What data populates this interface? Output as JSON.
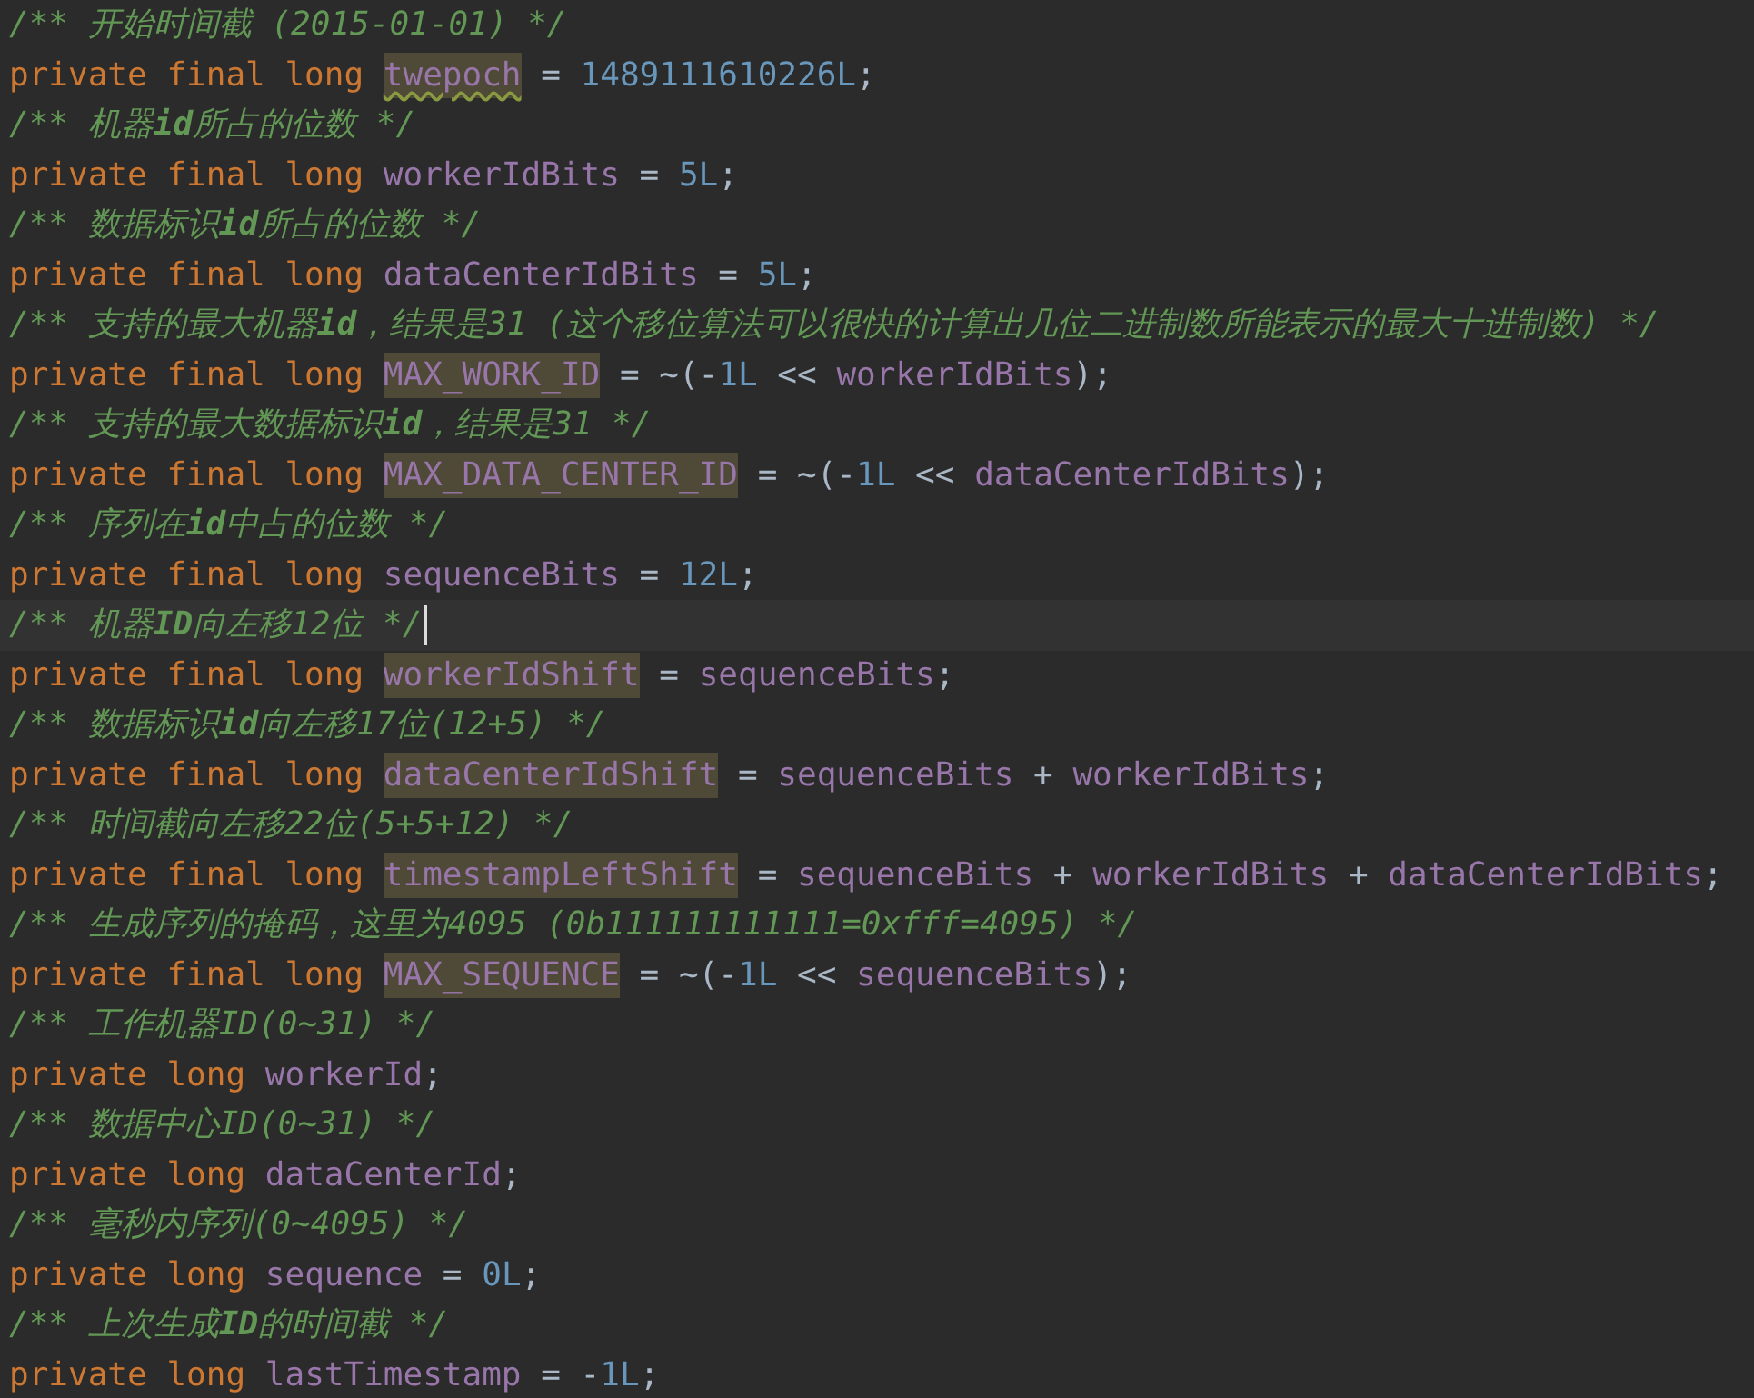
{
  "editor": {
    "lines": [
      {
        "kind": "comment",
        "current": false,
        "text": "/** 开始时间截 (2015-01-01) */"
      },
      {
        "kind": "code",
        "current": false,
        "tokens": [
          {
            "kind": "keyword",
            "text": "private final long "
          },
          {
            "kind": "field",
            "text": "twepoch",
            "highlighted": true,
            "warning": true
          },
          {
            "kind": "plain",
            "text": " = "
          },
          {
            "kind": "number",
            "text": "1489111610226L"
          },
          {
            "kind": "plain",
            "text": ";"
          }
        ]
      },
      {
        "kind": "comment",
        "current": false,
        "text": "/** 机器**id**所占的位数 */"
      },
      {
        "kind": "code",
        "current": false,
        "tokens": [
          {
            "kind": "keyword",
            "text": "private final long "
          },
          {
            "kind": "field",
            "text": "workerIdBits",
            "highlighted": false,
            "warning": false
          },
          {
            "kind": "plain",
            "text": " = "
          },
          {
            "kind": "number",
            "text": "5L"
          },
          {
            "kind": "plain",
            "text": ";"
          }
        ]
      },
      {
        "kind": "comment",
        "current": false,
        "text": "/** 数据标识**id**所占的位数 */"
      },
      {
        "kind": "code",
        "current": false,
        "tokens": [
          {
            "kind": "keyword",
            "text": "private final long "
          },
          {
            "kind": "field",
            "text": "dataCenterIdBits",
            "highlighted": false,
            "warning": false
          },
          {
            "kind": "plain",
            "text": " = "
          },
          {
            "kind": "number",
            "text": "5L"
          },
          {
            "kind": "plain",
            "text": ";"
          }
        ]
      },
      {
        "kind": "comment",
        "current": false,
        "text": "/** 支持的最大机器**id**，结果是31 (这个移位算法可以很快的计算出几位二进制数所能表示的最大十进制数) */"
      },
      {
        "kind": "code",
        "current": false,
        "tokens": [
          {
            "kind": "keyword",
            "text": "private final long "
          },
          {
            "kind": "field",
            "text": "MAX_WORK_ID",
            "highlighted": true,
            "warning": false
          },
          {
            "kind": "plain",
            "text": " = ~(-"
          },
          {
            "kind": "number",
            "text": "1L"
          },
          {
            "kind": "plain",
            "text": " << "
          },
          {
            "kind": "field",
            "text": "workerIdBits",
            "highlighted": false,
            "warning": false
          },
          {
            "kind": "plain",
            "text": ");"
          }
        ]
      },
      {
        "kind": "comment",
        "current": false,
        "text": "/** 支持的最大数据标识**id**，结果是31 */"
      },
      {
        "kind": "code",
        "current": false,
        "tokens": [
          {
            "kind": "keyword",
            "text": "private final long "
          },
          {
            "kind": "field",
            "text": "MAX_DATA_CENTER_ID",
            "highlighted": true,
            "warning": false
          },
          {
            "kind": "plain",
            "text": " = ~(-"
          },
          {
            "kind": "number",
            "text": "1L"
          },
          {
            "kind": "plain",
            "text": " << "
          },
          {
            "kind": "field",
            "text": "dataCenterIdBits",
            "highlighted": false,
            "warning": false
          },
          {
            "kind": "plain",
            "text": ");"
          }
        ]
      },
      {
        "kind": "comment",
        "current": false,
        "text": "/** 序列在**id**中占的位数 */"
      },
      {
        "kind": "code",
        "current": false,
        "tokens": [
          {
            "kind": "keyword",
            "text": "private final long "
          },
          {
            "kind": "field",
            "text": "sequenceBits",
            "highlighted": false,
            "warning": false
          },
          {
            "kind": "plain",
            "text": " = "
          },
          {
            "kind": "number",
            "text": "12L"
          },
          {
            "kind": "plain",
            "text": ";"
          }
        ]
      },
      {
        "kind": "comment",
        "current": true,
        "text": "/** 机器**ID**向左移12位 */"
      },
      {
        "kind": "code",
        "current": false,
        "tokens": [
          {
            "kind": "keyword",
            "text": "private final long "
          },
          {
            "kind": "field",
            "text": "workerIdShift",
            "highlighted": true,
            "warning": false
          },
          {
            "kind": "plain",
            "text": " = "
          },
          {
            "kind": "field",
            "text": "sequenceBits",
            "highlighted": false,
            "warning": false
          },
          {
            "kind": "plain",
            "text": ";"
          }
        ]
      },
      {
        "kind": "comment",
        "current": false,
        "text": "/** 数据标识**id**向左移17位(12+5) */"
      },
      {
        "kind": "code",
        "current": false,
        "tokens": [
          {
            "kind": "keyword",
            "text": "private final long "
          },
          {
            "kind": "field",
            "text": "dataCenterIdShift",
            "highlighted": true,
            "warning": false
          },
          {
            "kind": "plain",
            "text": " = "
          },
          {
            "kind": "field",
            "text": "sequenceBits",
            "highlighted": false,
            "warning": false
          },
          {
            "kind": "plain",
            "text": " + "
          },
          {
            "kind": "field",
            "text": "workerIdBits",
            "highlighted": false,
            "warning": false
          },
          {
            "kind": "plain",
            "text": ";"
          }
        ]
      },
      {
        "kind": "comment",
        "current": false,
        "text": "/** 时间截向左移22位(5+5+12) */"
      },
      {
        "kind": "code",
        "current": false,
        "tokens": [
          {
            "kind": "keyword",
            "text": "private final long "
          },
          {
            "kind": "field",
            "text": "timestampLeftShift",
            "highlighted": true,
            "warning": false
          },
          {
            "kind": "plain",
            "text": " = "
          },
          {
            "kind": "field",
            "text": "sequenceBits",
            "highlighted": false,
            "warning": false
          },
          {
            "kind": "plain",
            "text": " + "
          },
          {
            "kind": "field",
            "text": "workerIdBits",
            "highlighted": false,
            "warning": false
          },
          {
            "kind": "plain",
            "text": " + "
          },
          {
            "kind": "field",
            "text": "dataCenterIdBits",
            "highlighted": false,
            "warning": false
          },
          {
            "kind": "plain",
            "text": ";"
          }
        ]
      },
      {
        "kind": "comment",
        "current": false,
        "text": "/** 生成序列的掩码，这里为4095 (0b111111111111=0xfff=4095) */"
      },
      {
        "kind": "code",
        "current": false,
        "tokens": [
          {
            "kind": "keyword",
            "text": "private final long "
          },
          {
            "kind": "field",
            "text": "MAX_SEQUENCE",
            "highlighted": true,
            "warning": false
          },
          {
            "kind": "plain",
            "text": " = ~(-"
          },
          {
            "kind": "number",
            "text": "1L"
          },
          {
            "kind": "plain",
            "text": " << "
          },
          {
            "kind": "field",
            "text": "sequenceBits",
            "highlighted": false,
            "warning": false
          },
          {
            "kind": "plain",
            "text": ");"
          }
        ]
      },
      {
        "kind": "comment",
        "current": false,
        "text": "/** 工作机器ID(0~31) */"
      },
      {
        "kind": "code",
        "current": false,
        "tokens": [
          {
            "kind": "keyword",
            "text": "private long "
          },
          {
            "kind": "field",
            "text": "workerId",
            "highlighted": false,
            "warning": false
          },
          {
            "kind": "plain",
            "text": ";"
          }
        ]
      },
      {
        "kind": "comment",
        "current": false,
        "text": "/** 数据中心ID(0~31) */"
      },
      {
        "kind": "code",
        "current": false,
        "tokens": [
          {
            "kind": "keyword",
            "text": "private long "
          },
          {
            "kind": "field",
            "text": "dataCenterId",
            "highlighted": false,
            "warning": false
          },
          {
            "kind": "plain",
            "text": ";"
          }
        ]
      },
      {
        "kind": "comment",
        "current": false,
        "text": "/** 毫秒内序列(0~4095) */"
      },
      {
        "kind": "code",
        "current": false,
        "tokens": [
          {
            "kind": "keyword",
            "text": "private long "
          },
          {
            "kind": "field",
            "text": "sequence",
            "highlighted": false,
            "warning": false
          },
          {
            "kind": "plain",
            "text": " = "
          },
          {
            "kind": "number",
            "text": "0L"
          },
          {
            "kind": "plain",
            "text": ";"
          }
        ]
      },
      {
        "kind": "comment",
        "current": false,
        "text": "/** 上次生成**ID**的时间截 */"
      },
      {
        "kind": "code",
        "current": false,
        "tokens": [
          {
            "kind": "keyword",
            "text": "private long "
          },
          {
            "kind": "field",
            "text": "lastTimestamp",
            "highlighted": false,
            "warning": false
          },
          {
            "kind": "plain",
            "text": " = -"
          },
          {
            "kind": "number",
            "text": "1L"
          },
          {
            "kind": "plain",
            "text": ";"
          }
        ]
      }
    ]
  }
}
